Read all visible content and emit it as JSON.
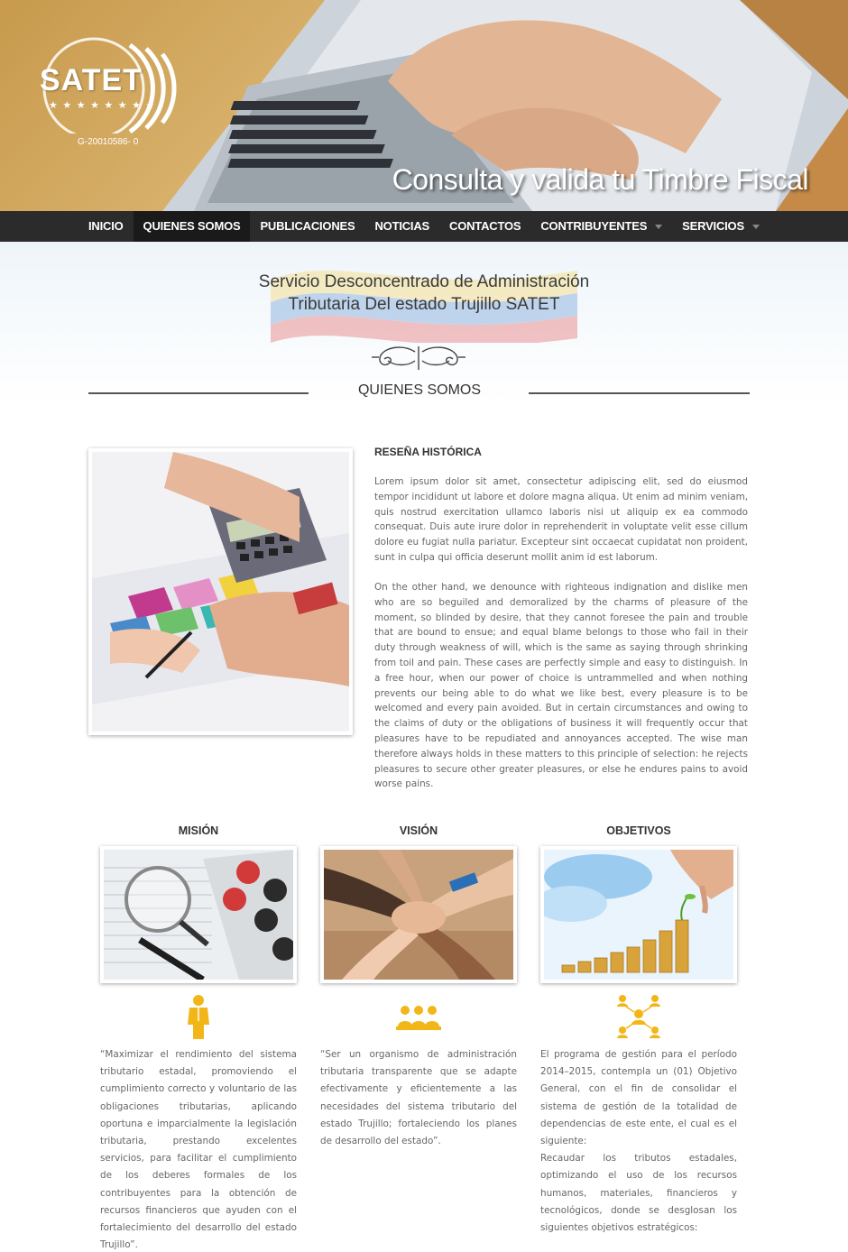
{
  "header": {
    "logo_text": "SATET",
    "logo_code": "G-20010586- 0",
    "logo_stars": "★ ★ ★ ★ ★ ★ ★ ★",
    "slogan": "Consulta y valida tu Timbre Fiscal"
  },
  "nav": {
    "items": [
      {
        "label": "INICIO"
      },
      {
        "label": "QUIENES SOMOS"
      },
      {
        "label": "PUBLICACIONES"
      },
      {
        "label": "NOTICIAS"
      },
      {
        "label": "CONTACTOS"
      },
      {
        "label": "CONTRIBUYENTES"
      },
      {
        "label": "SERVICIOS"
      }
    ],
    "active_index": 1
  },
  "intro": {
    "title_line1": "Servicio Desconcentrado de Administración",
    "title_line2": "Tributaria Del estado Trujillo SATET",
    "section_title": "QUIENES SOMOS"
  },
  "history": {
    "heading": "RESEÑA HISTÓRICA",
    "paragraph1": "Lorem ipsum dolor sit amet, consectetur adipiscing elit, sed do eiusmod tempor incididunt ut labore et dolore magna aliqua. Ut enim ad minim veniam, quis nostrud exercitation ullamco laboris nisi ut aliquip ex ea commodo consequat. Duis aute irure dolor in reprehenderit in voluptate velit esse cillum dolore eu fugiat nulla pariatur. Excepteur sint occaecat cupidatat non proident, sunt in culpa qui officia deserunt mollit anim id est laborum.",
    "paragraph2": "On the other hand, we denounce with righteous indignation and dislike men who are so beguiled and demoralized by the charms of pleasure of the moment, so blinded by desire, that they cannot foresee the pain and trouble that are bound to ensue; and equal blame belongs to those who fail in their duty through weakness of will, which is the same as saying through shrinking from toil and pain. These cases are perfectly simple and easy to distinguish. In a free hour, when our power of choice is untrammelled and when nothing prevents our being able to do what we like best, every pleasure is to be welcomed and every pain avoided. But in certain circumstances and owing to the claims of duty or the obligations of business it will frequently occur that pleasures have to be repudiated and annoyances accepted. The wise man therefore always holds in these matters to this principle of selection: he rejects pleasures to secure other greater pleasures, or else he endures pains to avoid worse pains."
  },
  "columns": [
    {
      "heading": "MISIÓN",
      "text": "“Maximizar el rendimiento del sistema tributario estadal, promoviendo el cumplimiento correcto y voluntario de las obligaciones tributarias, aplicando oportuna e imparcialmente la legislación tributaria, prestando excelentes servicios, para facilitar el cumplimiento de los deberes formales de los contribuyentes para la obtención de recursos financieros que ayuden con el fortalecimiento del desarrollo del estado Trujillo”."
    },
    {
      "heading": "VISIÓN",
      "text": "“Ser un organismo de administración tributaria transparente que se adapte efectivamente y eficientemente a las necesidades del sistema tributario del estado Trujillo; fortaleciendo los planes de desarrollo del estado”."
    },
    {
      "heading": "OBJETIVOS",
      "text": "El programa de gestión para el período 2014–2015, contempla un (01) Objetivo General, con el fin de consolidar el sistema de gestión de la totalidad de dependencias de este ente, el cual es el siguiente:",
      "text2": "Recaudar los tributos estadales, optimizando el uso de los recursos humanos, materiales, financieros y tecnológicos, donde se desglosan los siguientes objetivos estratégicos:"
    }
  ],
  "colors": {
    "nav_bg": "#2b2b2b",
    "nav_active": "#1a1a1a",
    "accent_yellow": "#f2b619",
    "banner_gold": "#d8b06a"
  }
}
